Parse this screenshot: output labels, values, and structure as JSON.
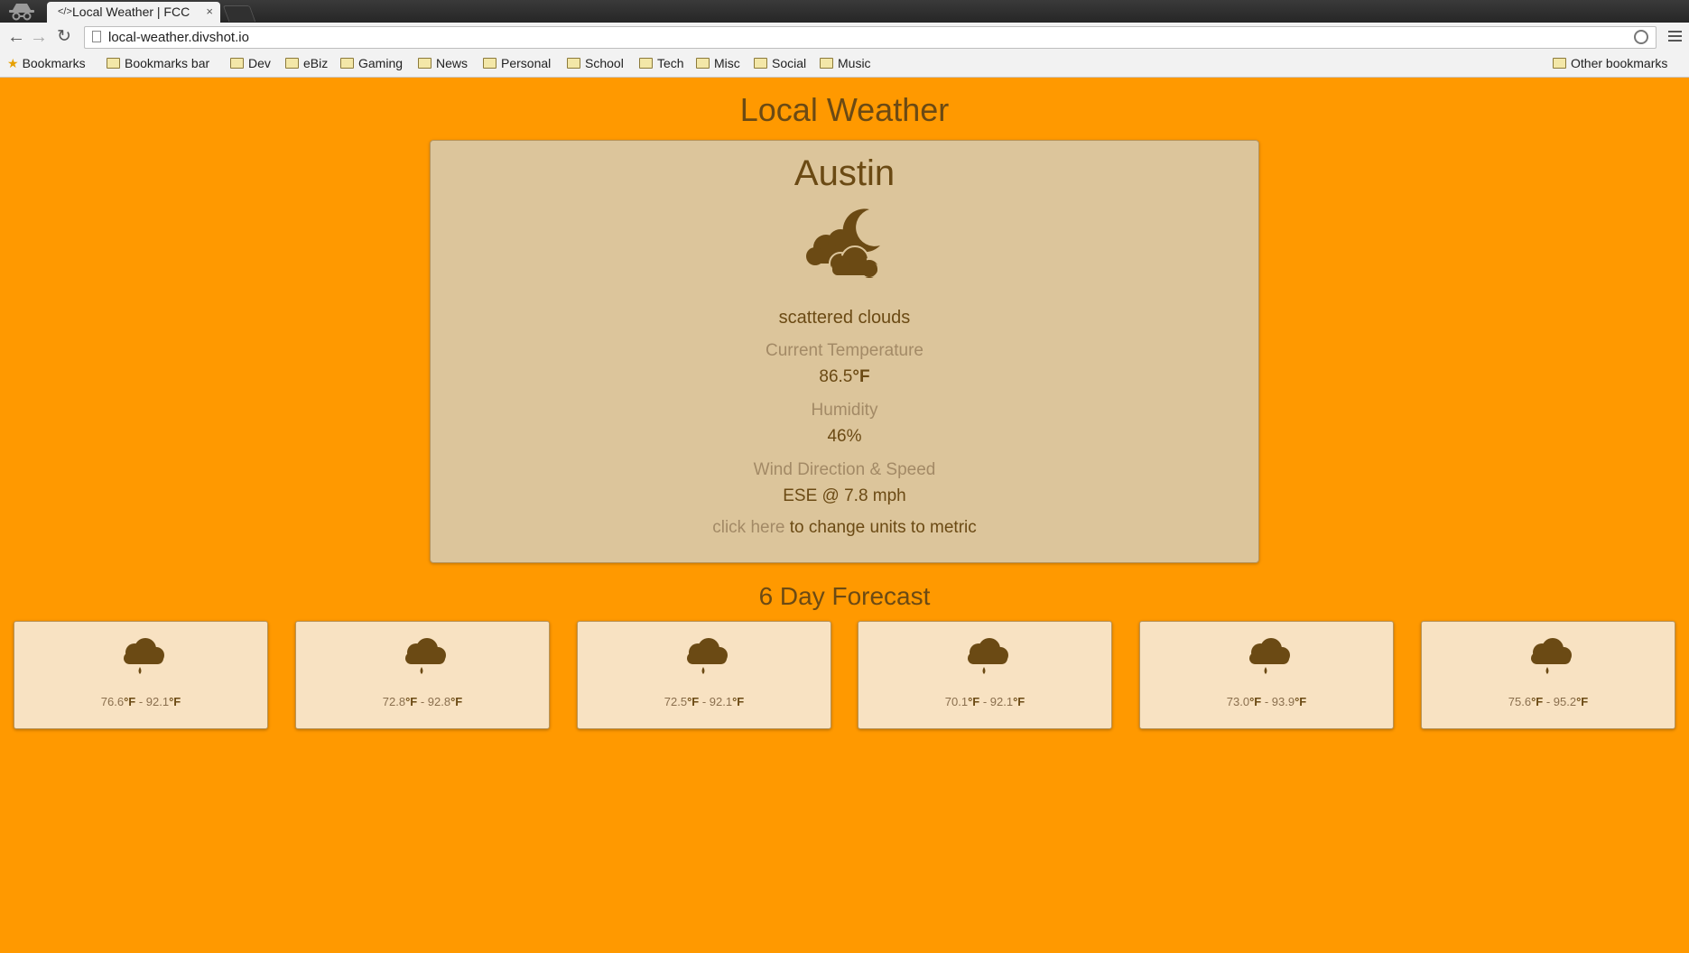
{
  "browser": {
    "tab_title": "Local Weather | FCC",
    "tab_close": "×",
    "url": "local-weather.divshot.io",
    "bookmarks": [
      "Bookmarks",
      "Bookmarks bar",
      "Dev",
      "eBiz",
      "Gaming",
      "News",
      "Personal",
      "School",
      "Tech",
      "Misc",
      "Social",
      "Music"
    ],
    "other_bookmarks": "Other bookmarks"
  },
  "page": {
    "title": "Local Weather",
    "city": "Austin",
    "description": "scattered clouds",
    "temp_label": "Current Temperature",
    "temp_value": "86.5",
    "temp_unit": "°F",
    "humidity_label": "Humidity",
    "humidity_value": "46%",
    "wind_label": "Wind Direction & Speed",
    "wind_value": "ESE @ 7.8 mph",
    "toggle_link": "click here",
    "toggle_text": " to change units to metric",
    "forecast_title": "6 Day Forecast",
    "main_icon": "cloud-moon-icon",
    "forecast": [
      {
        "low": "76.6",
        "high": "92.1",
        "unit": "°F",
        "sep": " - ",
        "icon": "rain-cloud-icon"
      },
      {
        "low": "72.8",
        "high": "92.8",
        "unit": "°F",
        "sep": " - ",
        "icon": "rain-cloud-icon"
      },
      {
        "low": "72.5",
        "high": "92.1",
        "unit": "°F",
        "sep": " - ",
        "icon": "rain-cloud-icon"
      },
      {
        "low": "70.1",
        "high": "92.1",
        "unit": "°F",
        "sep": " - ",
        "icon": "rain-cloud-icon"
      },
      {
        "low": "73.0",
        "high": "93.9",
        "unit": "°F",
        "sep": " - ",
        "icon": "rain-cloud-icon"
      },
      {
        "low": "75.6",
        "high": "95.2",
        "unit": "°F",
        "sep": " - ",
        "icon": "rain-cloud-icon"
      }
    ]
  },
  "colors": {
    "background": "#ff9900",
    "card": "#dcc59b",
    "forecast_card": "#f8e2c2",
    "text_dark": "#6b4a14",
    "text_muted": "#a38a66"
  }
}
